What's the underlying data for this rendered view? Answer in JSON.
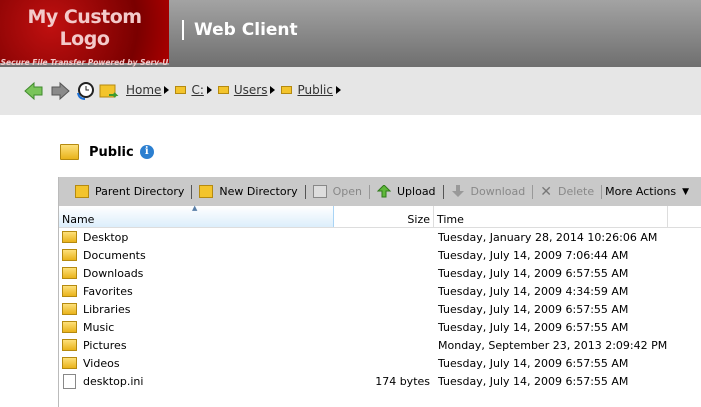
{
  "header": {
    "logo_text": "My Custom Logo",
    "logo_subtext": "Secure File Transfer Powered by Serv-U",
    "title": "Web Client"
  },
  "nav": {
    "back": "back-arrow-icon",
    "forward": "forward-arrow-icon",
    "history": "history-icon",
    "sync": "folder-sync-icon",
    "breadcrumbs": [
      {
        "label": "Home"
      },
      {
        "label": "C:"
      },
      {
        "label": "Users"
      },
      {
        "label": "Public"
      }
    ]
  },
  "folder": {
    "title": "Public"
  },
  "toolbar": {
    "parent": "Parent Directory",
    "new_dir": "New Directory",
    "open": "Open",
    "upload": "Upload",
    "download": "Download",
    "delete": "Delete",
    "more": "More Actions"
  },
  "columns": {
    "name": "Name",
    "size": "Size",
    "time": "Time"
  },
  "files": [
    {
      "name": "Desktop",
      "size": "",
      "time": "Tuesday, January 28, 2014 10:26:06 AM",
      "type": "folder"
    },
    {
      "name": "Documents",
      "size": "",
      "time": "Tuesday, July 14, 2009 7:06:44 AM",
      "type": "folder"
    },
    {
      "name": "Downloads",
      "size": "",
      "time": "Tuesday, July 14, 2009 6:57:55 AM",
      "type": "folder"
    },
    {
      "name": "Favorites",
      "size": "",
      "time": "Tuesday, July 14, 2009 4:34:59 AM",
      "type": "folder"
    },
    {
      "name": "Libraries",
      "size": "",
      "time": "Tuesday, July 14, 2009 6:57:55 AM",
      "type": "folder"
    },
    {
      "name": "Music",
      "size": "",
      "time": "Tuesday, July 14, 2009 6:57:55 AM",
      "type": "folder"
    },
    {
      "name": "Pictures",
      "size": "",
      "time": "Monday, September 23, 2013 2:09:42 PM",
      "type": "folder"
    },
    {
      "name": "Videos",
      "size": "",
      "time": "Tuesday, July 14, 2009 6:57:55 AM",
      "type": "folder"
    },
    {
      "name": "desktop.ini",
      "size": "174 bytes",
      "time": "Tuesday, July 14, 2009 6:57:55 AM",
      "type": "file"
    }
  ]
}
